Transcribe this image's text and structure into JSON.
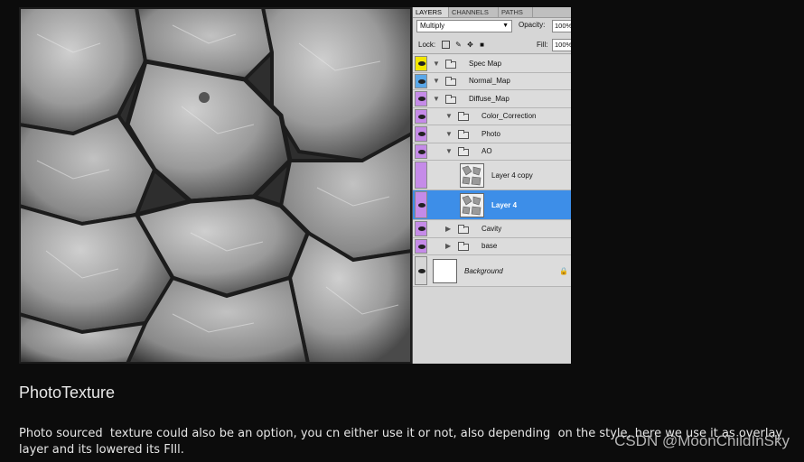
{
  "layers_panel": {
    "tabs": [
      "LAYERS",
      "CHANNELS",
      "PATHS"
    ],
    "blend_mode": "Multiply",
    "opacity_label": "Opacity:",
    "opacity_value": "100%",
    "lock_label": "Lock:",
    "fill_label": "Fill:",
    "fill_value": "100%",
    "layers": [
      {
        "name": "Spec Map",
        "eye_color": "#f2e600",
        "kind": "folder",
        "indent": 0,
        "expanded": true,
        "visible": true
      },
      {
        "name": "Normal_Map",
        "eye_color": "#5aa7e8",
        "kind": "folder",
        "indent": 0,
        "expanded": true,
        "visible": true
      },
      {
        "name": "Diffuse_Map",
        "eye_color": "#c58be8",
        "kind": "folder",
        "indent": 0,
        "expanded": true,
        "visible": true
      },
      {
        "name": "Color_Correction",
        "eye_color": "#c58be8",
        "kind": "folder",
        "indent": 1,
        "expanded": true,
        "visible": true
      },
      {
        "name": "Photo",
        "eye_color": "#c58be8",
        "kind": "folder",
        "indent": 1,
        "expanded": true,
        "visible": true
      },
      {
        "name": "AO",
        "eye_color": "#c58be8",
        "kind": "folder",
        "indent": 1,
        "expanded": true,
        "visible": true
      },
      {
        "name": "Layer 4 copy",
        "eye_color": "#c58be8",
        "kind": "image",
        "indent": 2,
        "visible": false
      },
      {
        "name": "Layer 4",
        "eye_color": "#c58be8",
        "kind": "image",
        "indent": 2,
        "visible": true,
        "selected": true
      },
      {
        "name": "Cavity",
        "eye_color": "#c58be8",
        "kind": "folder",
        "indent": 1,
        "expanded": false,
        "visible": true
      },
      {
        "name": "base",
        "eye_color": "#c58be8",
        "kind": "folder",
        "indent": 1,
        "expanded": false,
        "visible": true
      },
      {
        "name": "Background",
        "eye_color": "#d6d6d6",
        "kind": "background",
        "indent": 0,
        "visible": true,
        "locked": true
      }
    ]
  },
  "caption": {
    "heading": "PhotoTexture",
    "body": "Photo sourced  texture could also be an option, you cn either use it or not, also depending  on the style, here we use it as overlay layer and its lowered its FIll."
  },
  "watermark": "CSDN @MoonChildInSky"
}
